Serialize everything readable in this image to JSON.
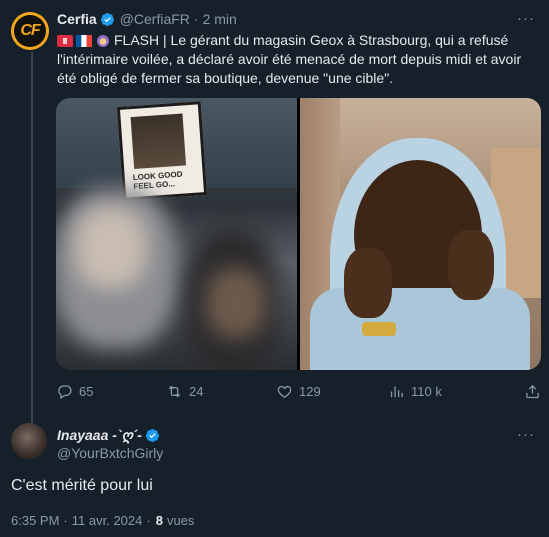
{
  "tweet": {
    "author_name": "Cerfia",
    "author_handle": "@CerfiaFR",
    "time_ago": "2 min",
    "avatar_text": "CF",
    "text": "FLASH | Le gérant du magasin Geox à Strasbourg, qui a refusé l'intérimaire voilée, a déclaré avoir été menacé de mort depuis midi et avoir été obligé de fermer sa boutique, devenue \"une cible\".",
    "poster_text": "LOOK GOOD FEEL GO...",
    "actions": {
      "replies": "65",
      "retweets": "24",
      "likes": "129",
      "views": "110 k"
    }
  },
  "reply": {
    "author_name": "Inayaaa -`ღ´-",
    "author_handle": "@YourBxtchGirly",
    "text": "C'est mérité pour lui",
    "time": "6:35 PM",
    "date": "11 avr. 2024",
    "views_count": "8",
    "views_label": "vues"
  },
  "colors": {
    "background": "#15202b",
    "verified": "#1d9bf0",
    "muted": "#8b98a5"
  }
}
